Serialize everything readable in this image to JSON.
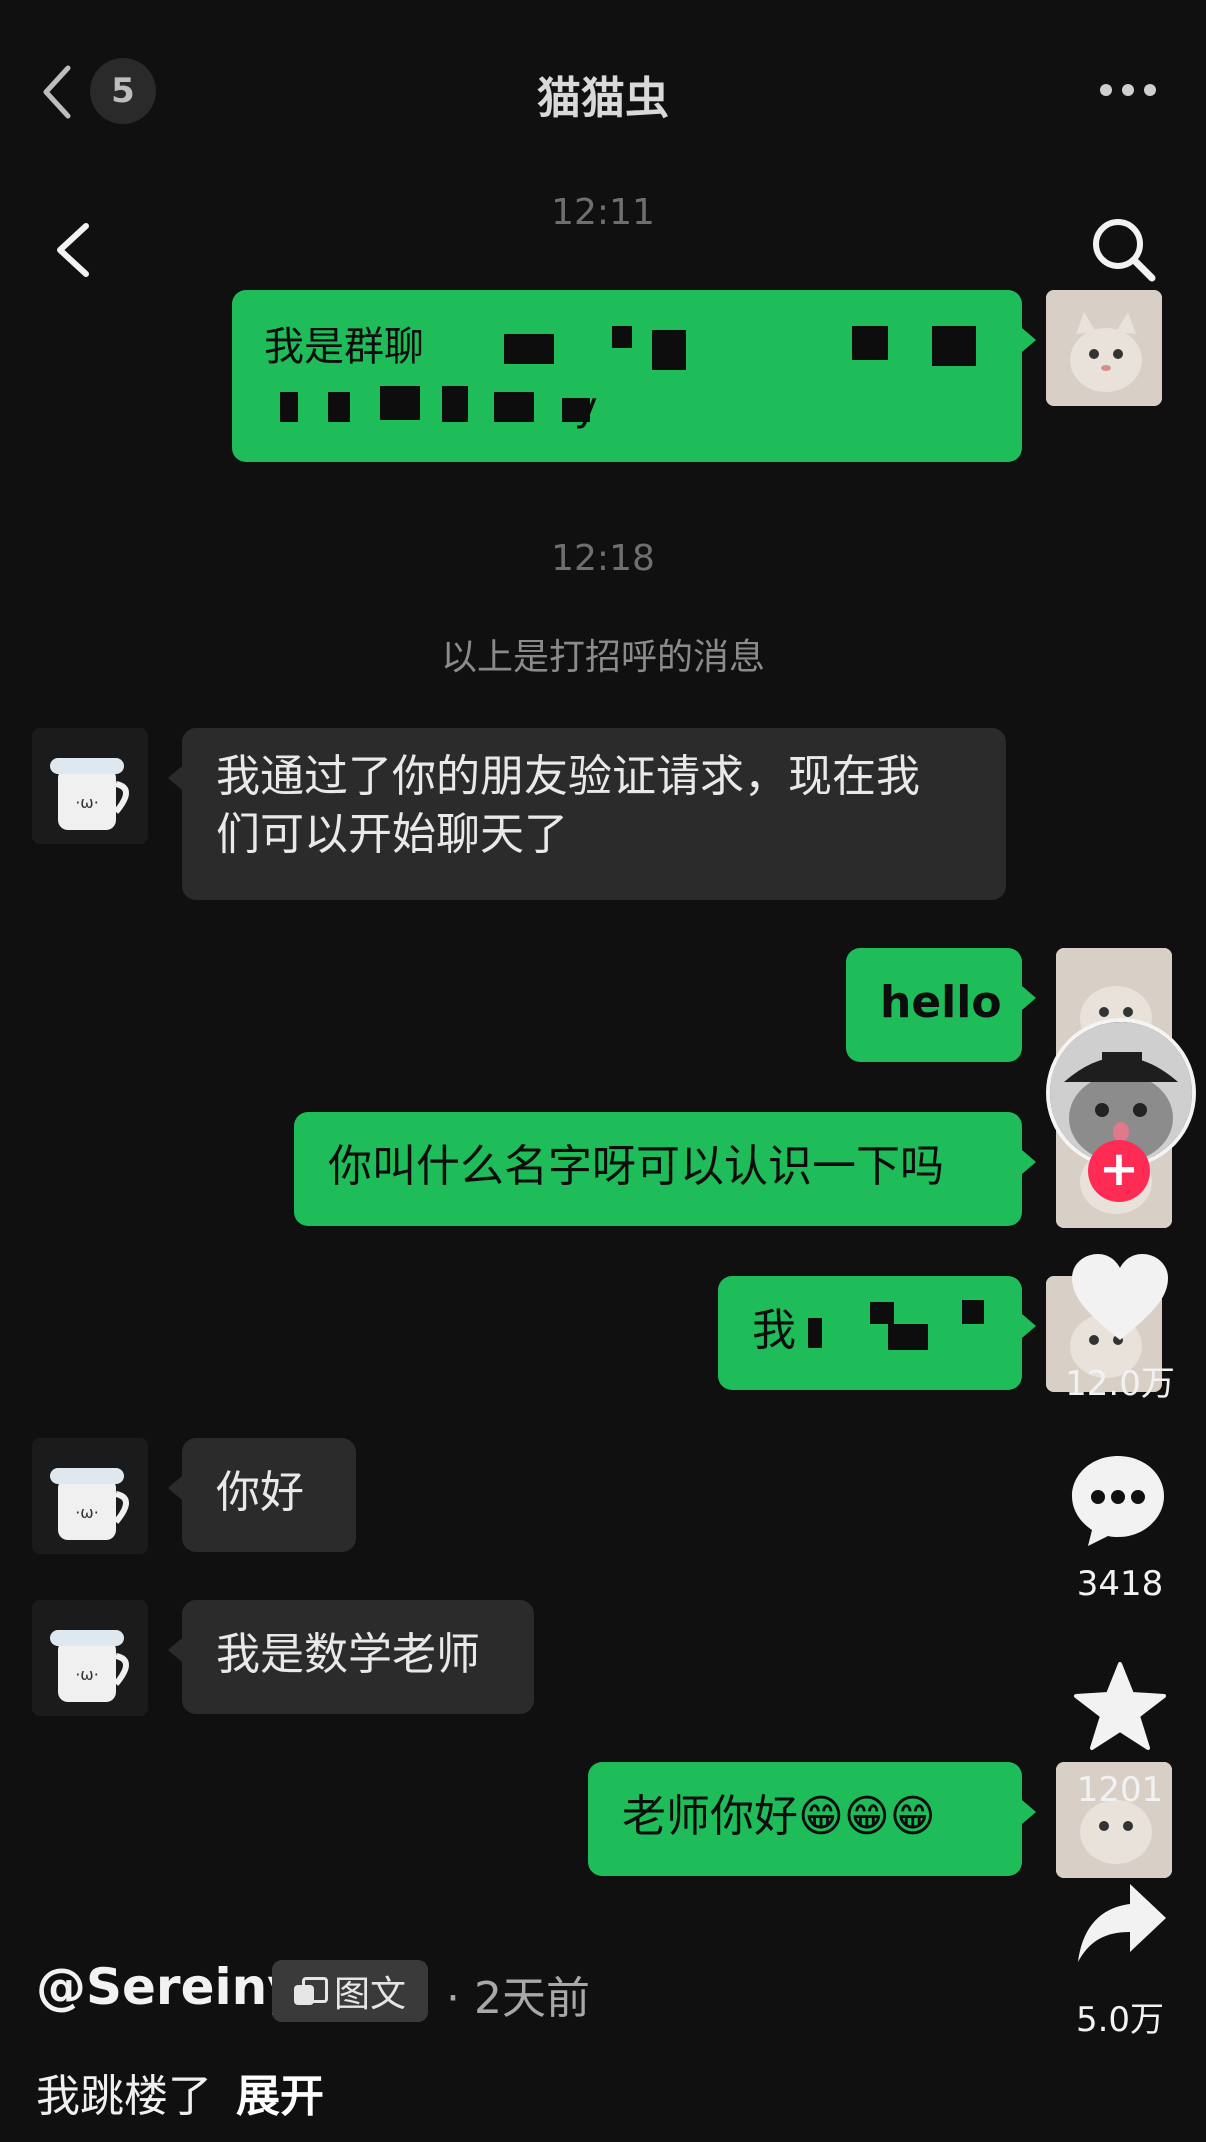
{
  "header": {
    "title": "猫猫虫",
    "unread_count": "5"
  },
  "chat": {
    "time1": "12:11",
    "msg1_line1": "我是群聊",
    "msg1_line2_end": "y",
    "time2": "12:18",
    "system_note": "以上是打招呼的消息",
    "msg2_line1": "我通过了你的朋友验证请求，现在我",
    "msg2_line2": "们可以开始聊天了",
    "msg3": "hello",
    "msg4": "你叫什么名字呀可以认识一下吗",
    "msg5": "我",
    "msg6": "你好",
    "msg7": "我是数学老师",
    "msg8": "老师你好😁😁😁"
  },
  "rail": {
    "likes": "12.0万",
    "comments": "3418",
    "favorites": "1201",
    "shares": "5.0万"
  },
  "post": {
    "author": "@Sereiny",
    "type_label": "图文",
    "time": "· 2天前",
    "caption": "我跳楼了",
    "expand": "展开"
  },
  "icons": {
    "back": "chevron-left-icon",
    "search": "search-icon",
    "more": "more-dots-icon",
    "like": "heart-icon",
    "comment": "comment-bubble-icon",
    "favorite": "star-icon",
    "share": "share-arrow-icon"
  },
  "colors": {
    "background": "#101010",
    "sent_bubble": "#1fbd5a",
    "received_bubble": "#2b2b2b",
    "follow_plus": "#fe2c55"
  }
}
